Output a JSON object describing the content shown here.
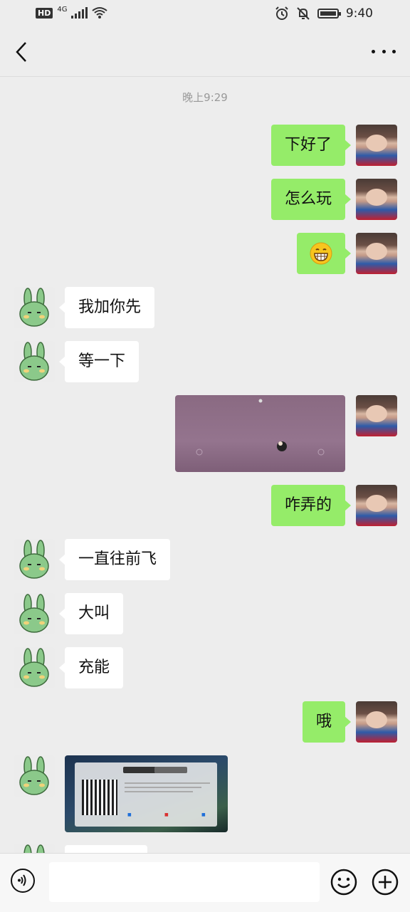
{
  "status_bar": {
    "hd": "HD",
    "network": "4G",
    "time": "9:40"
  },
  "header": {
    "title": ""
  },
  "chat": {
    "time_label": "晚上9:29",
    "messages": [
      {
        "side": "me",
        "type": "text",
        "text": "下好了"
      },
      {
        "side": "me",
        "type": "text",
        "text": "怎么玩"
      },
      {
        "side": "me",
        "type": "emoji",
        "icon": "grinning-emoji"
      },
      {
        "side": "them",
        "type": "text",
        "text": "我加你先"
      },
      {
        "side": "them",
        "type": "text",
        "text": "等一下"
      },
      {
        "side": "me",
        "type": "image",
        "icon": "game-screenshot"
      },
      {
        "side": "me",
        "type": "text",
        "text": "咋弄的"
      },
      {
        "side": "them",
        "type": "text",
        "text": "一直往前飞"
      },
      {
        "side": "them",
        "type": "text",
        "text": "大叫"
      },
      {
        "side": "them",
        "type": "text",
        "text": "充能"
      },
      {
        "side": "me",
        "type": "text",
        "text": "哦"
      },
      {
        "side": "them",
        "type": "image",
        "icon": "qr-code-screenshot"
      }
    ]
  },
  "input_bar": {
    "value": "",
    "placeholder": ""
  },
  "colors": {
    "background": "#ededed",
    "my_bubble": "#95ec69",
    "their_bubble": "#ffffff"
  }
}
